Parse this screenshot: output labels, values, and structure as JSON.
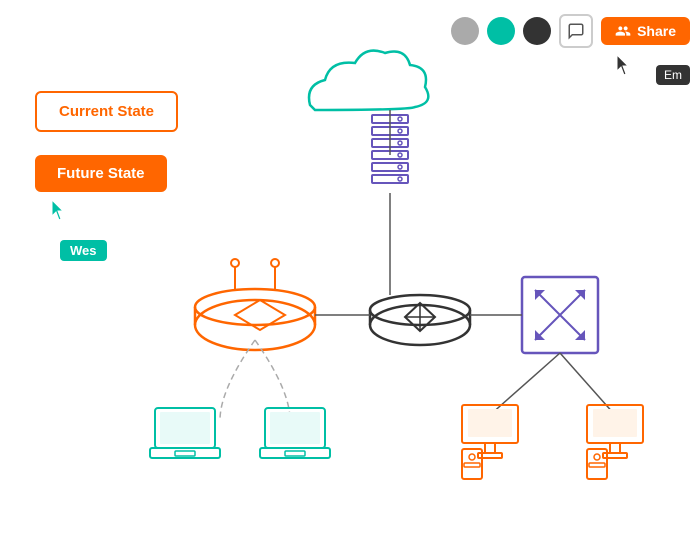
{
  "toolbar": {
    "share_label": "Share",
    "colors": [
      "gray",
      "teal",
      "dark"
    ],
    "comment_icon": "💬"
  },
  "avatars": {
    "em_label": "Em",
    "wes_label": "Wes"
  },
  "buttons": {
    "current_state": "Current State",
    "future_state": "Future State"
  },
  "network": {
    "nodes": [
      "cloud",
      "firewall",
      "router-orange",
      "router-black",
      "switch-purple",
      "laptops-teal-1",
      "laptops-teal-2",
      "desktop-orange-1",
      "desktop-orange-2"
    ]
  }
}
